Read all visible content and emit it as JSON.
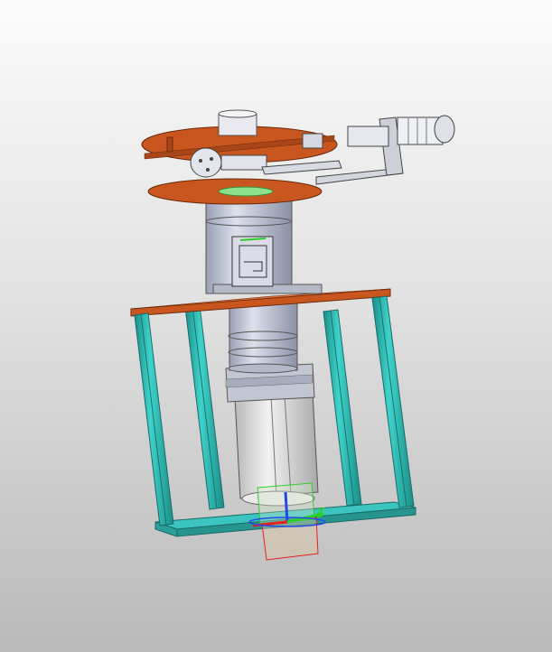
{
  "viewport": {
    "background_top": "#fbfbfb",
    "background_bottom": "#b9b9b9"
  },
  "model": {
    "plate_color": "#c8561e",
    "column_color": "#2bbcb4",
    "motor_color": "#bfc5d6",
    "base_color": "#3cc4c0"
  },
  "triad": {
    "x_color": "#e52121",
    "y_color": "#2bd12b",
    "z_color": "#2149e5",
    "y_label": "Y"
  }
}
